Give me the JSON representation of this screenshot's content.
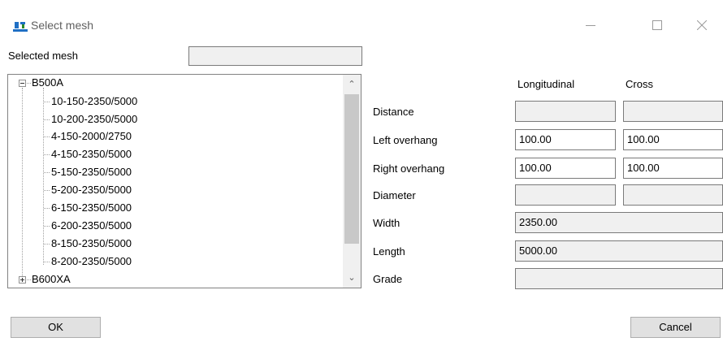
{
  "window": {
    "title": "Select mesh"
  },
  "selected_mesh": {
    "label": "Selected mesh",
    "value": ""
  },
  "tree": {
    "groups": [
      {
        "label": "B500A",
        "expanded": true,
        "items": [
          "10-150-2350/5000",
          "10-200-2350/5000",
          "4-150-2000/2750",
          "4-150-2350/5000",
          "5-150-2350/5000",
          "5-200-2350/5000",
          "6-150-2350/5000",
          "6-200-2350/5000",
          "8-150-2350/5000",
          "8-200-2350/5000"
        ]
      },
      {
        "label": "B600XA",
        "expanded": false,
        "items": []
      }
    ]
  },
  "props": {
    "col_longitudinal": "Longitudinal",
    "col_cross": "Cross",
    "distance": {
      "label": "Distance",
      "longitudinal": "",
      "cross": ""
    },
    "left_overhang": {
      "label": "Left overhang",
      "longitudinal": "100.00",
      "cross": "100.00"
    },
    "right_overhang": {
      "label": "Right overhang",
      "longitudinal": "100.00",
      "cross": "100.00"
    },
    "diameter": {
      "label": "Diameter",
      "longitudinal": "",
      "cross": ""
    },
    "width": {
      "label": "Width",
      "value": "2350.00"
    },
    "length": {
      "label": "Length",
      "value": "5000.00"
    },
    "grade": {
      "label": "Grade",
      "value": ""
    }
  },
  "buttons": {
    "ok": "OK",
    "cancel": "Cancel"
  },
  "colors": {
    "icon_blue": "#1f6fc4",
    "icon_green": "#2a8a2a"
  }
}
